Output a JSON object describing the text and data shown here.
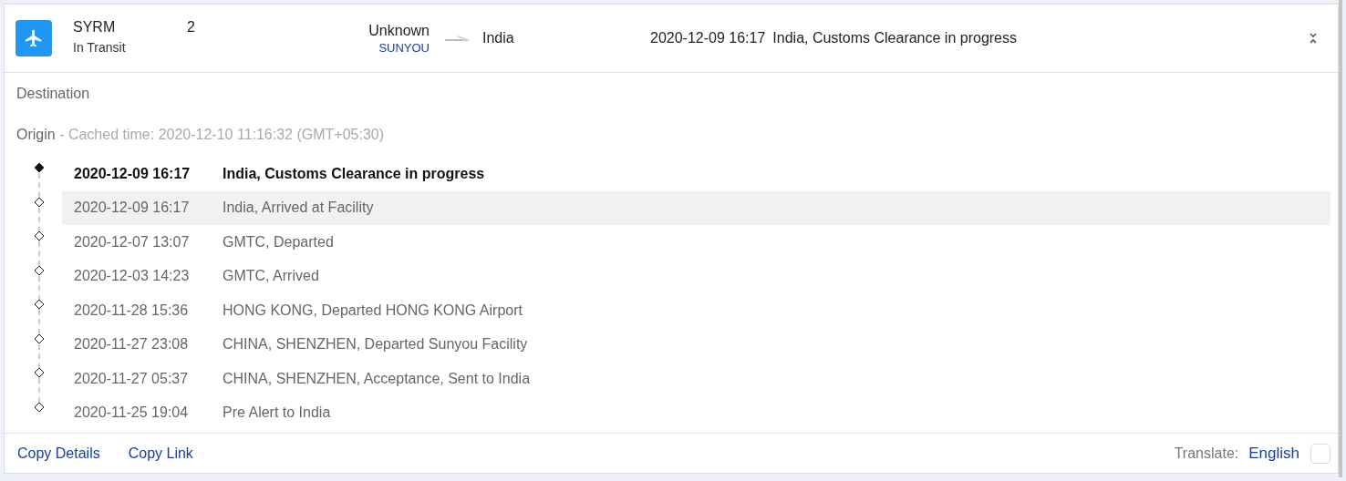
{
  "shipment": {
    "code": "SYRM",
    "status": "In Transit",
    "count": "2",
    "origin": "Unknown",
    "carrier": "SUNYOU",
    "destination": "India",
    "latest_time": "2020-12-09 16:17",
    "latest_event": "India, Customs Clearance in progress",
    "expanded": true
  },
  "destination_label": "Destination",
  "origin": {
    "label": "Origin",
    "cached": " - Cached time: 2020-12-10 11:16:32 (GMT+05:30)"
  },
  "events": [
    {
      "time": "2020-12-09 16:17",
      "text": "India, Customs Clearance in progress",
      "current": true,
      "selected": false
    },
    {
      "time": "2020-12-09 16:17",
      "text": "India, Arrived at Facility",
      "current": false,
      "selected": true
    },
    {
      "time": "2020-12-07 13:07",
      "text": "GMTC, Departed",
      "current": false,
      "selected": false
    },
    {
      "time": "2020-12-03 14:23",
      "text": "GMTC, Arrived",
      "current": false,
      "selected": false
    },
    {
      "time": "2020-11-28 15:36",
      "text": "HONG KONG, Departed HONG KONG Airport",
      "current": false,
      "selected": false
    },
    {
      "time": "2020-11-27 23:08",
      "text": "CHINA, SHENZHEN, Departed Sunyou Facility",
      "current": false,
      "selected": false
    },
    {
      "time": "2020-11-27 05:37",
      "text": "CHINA, SHENZHEN, Acceptance, Sent to India",
      "current": false,
      "selected": false
    },
    {
      "time": "2020-11-25 19:04",
      "text": "Pre Alert to India",
      "current": false,
      "selected": false
    }
  ],
  "footer": {
    "links": [
      "Copy Details",
      "Copy Link"
    ],
    "translate_label": "Translate:",
    "language": "English",
    "translate_checked": false
  }
}
